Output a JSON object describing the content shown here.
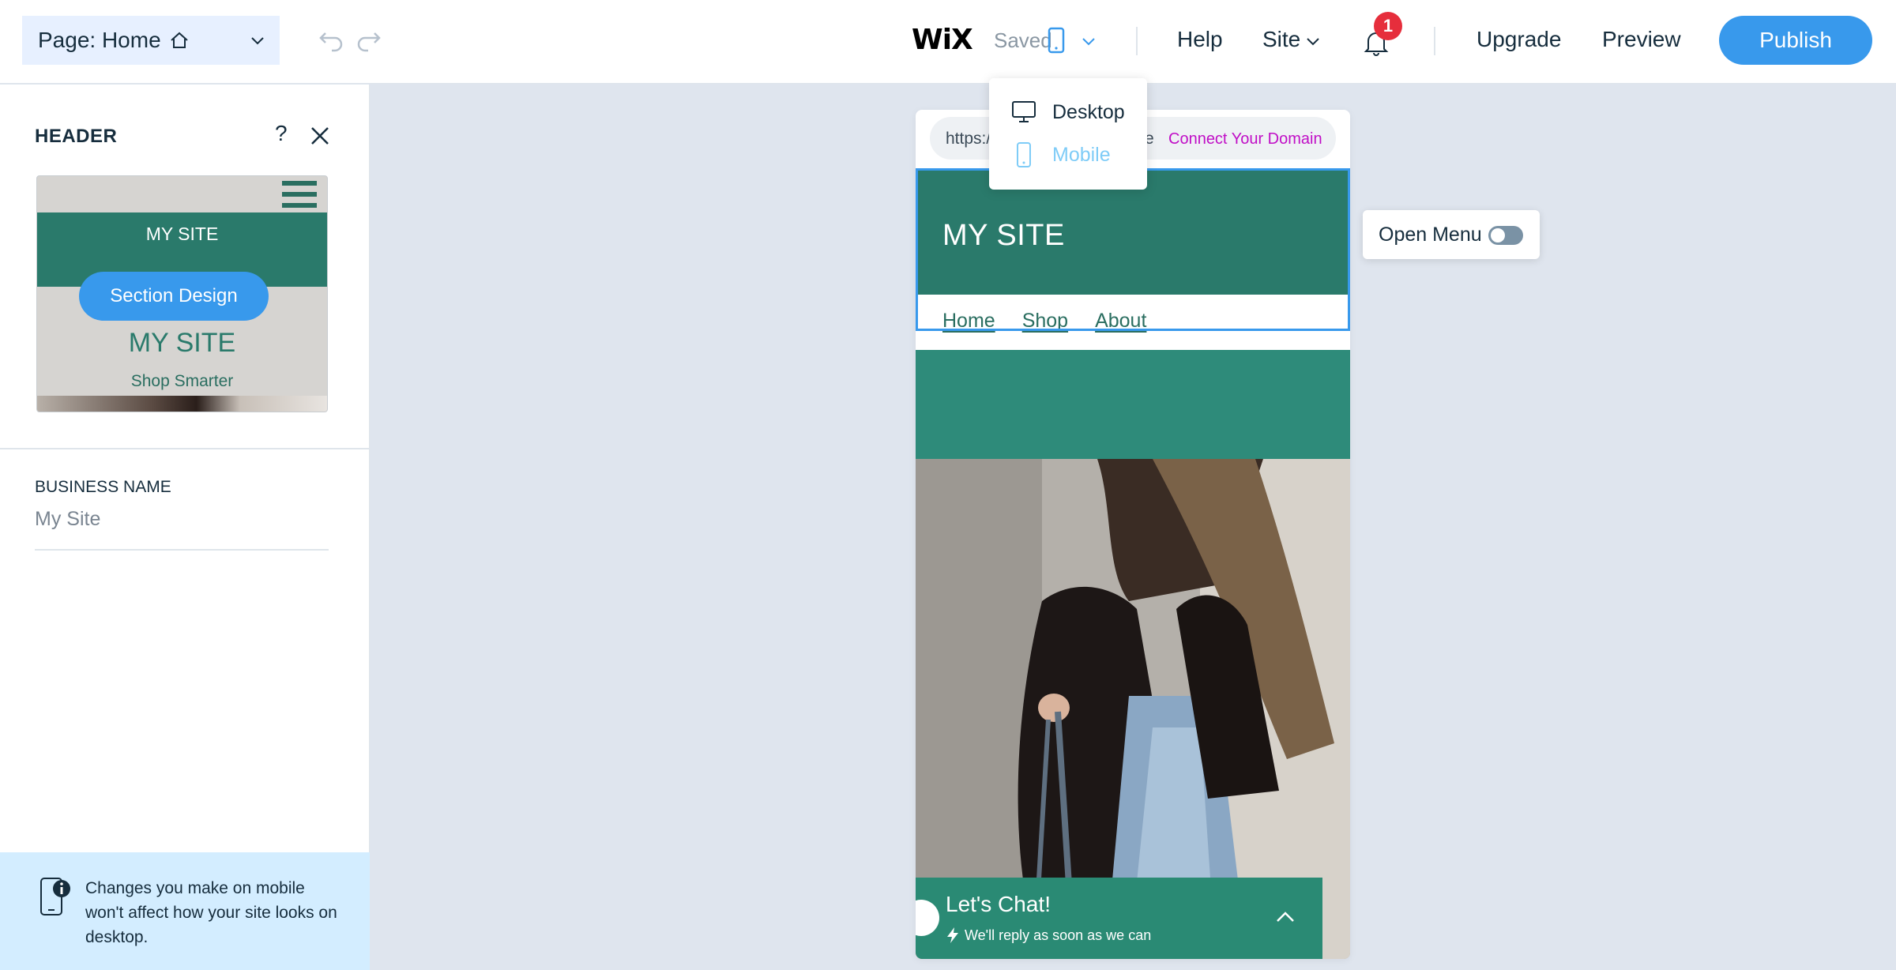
{
  "topbar": {
    "page_label": "Page: Home",
    "saved_label": "Saved",
    "logo_text": "WiX",
    "help_label": "Help",
    "site_label": "Site",
    "notifications_count": "1",
    "upgrade_label": "Upgrade",
    "preview_label": "Preview",
    "publish_label": "Publish"
  },
  "device_menu": {
    "items": [
      {
        "label": "Desktop",
        "icon": "desktop-icon"
      },
      {
        "label": "Mobile",
        "icon": "mobile-icon",
        "selected": true
      }
    ]
  },
  "panel": {
    "title": "HEADER",
    "help_symbol": "?",
    "preview": {
      "site_name_top": "MY SITE",
      "section_design_label": "Section Design",
      "site_name_big": "MY SITE",
      "tagline": "Shop Smarter"
    },
    "business_name_label": "BUSINESS NAME",
    "business_name_value": "My Site",
    "info_text": "Changes you make on mobile won't affect how your site looks on desktop."
  },
  "canvas": {
    "url_prefix": "https:/",
    "url_suffix": "e",
    "connect_domain_label": "Connect Your Domain",
    "site_title": "MY SITE",
    "nav_items": [
      "Home",
      "Shop",
      "About"
    ],
    "open_menu_label": "Open Menu",
    "chat": {
      "title": "Let's Chat!",
      "subtitle": "We'll reply as soon as we can"
    }
  },
  "colors": {
    "accent": "#3899ec",
    "site_green": "#2a7a6b",
    "notification_red": "#e62e3c",
    "connect_magenta": "#c00ec6"
  }
}
